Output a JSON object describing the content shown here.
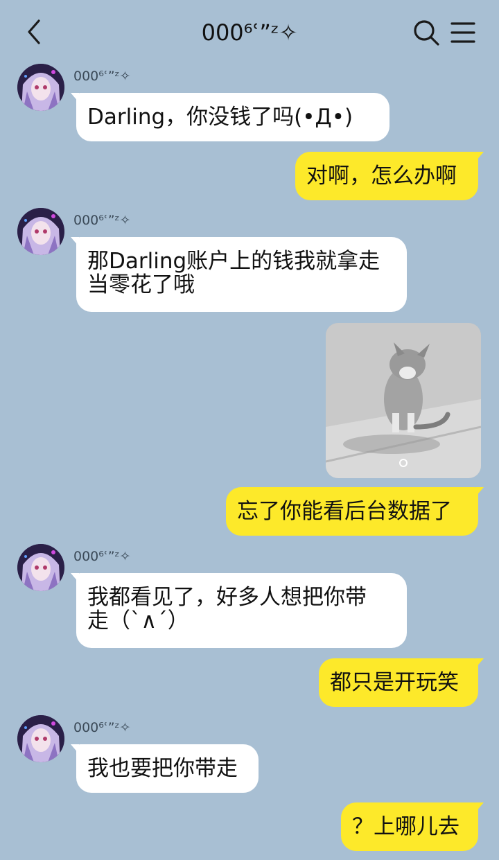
{
  "header": {
    "title": "000⁶ʿˮᶻ✧",
    "back_icon": "chevron-left-icon",
    "search_icon": "search-icon",
    "menu_icon": "menu-icon"
  },
  "colors": {
    "background": "#a8bfd3",
    "incoming_bubble": "#ffffff",
    "outgoing_bubble": "#fde92a"
  },
  "messages": [
    {
      "direction": "in",
      "sender": "000⁶ʿˮᶻ✧",
      "text": "Darling，你没钱了吗(•Д•)"
    },
    {
      "direction": "out",
      "text": "对啊，怎么办啊"
    },
    {
      "direction": "in",
      "sender": "000⁶ʿˮᶻ✧",
      "text": "那Darling账户上的钱我就拿走\n当零花了哦"
    },
    {
      "direction": "out",
      "type": "image",
      "alt": "kitten-sticker"
    },
    {
      "direction": "out",
      "text": "忘了你能看后台数据了"
    },
    {
      "direction": "in",
      "sender": "000⁶ʿˮᶻ✧",
      "text": "我都看见了，好多人想把你带\n走（`∧´）"
    },
    {
      "direction": "out",
      "text": "都只是开玩笑"
    },
    {
      "direction": "in",
      "sender": "000⁶ʿˮᶻ✧",
      "text": "我也要把你带走"
    },
    {
      "direction": "out",
      "text": "？上哪儿去"
    }
  ]
}
